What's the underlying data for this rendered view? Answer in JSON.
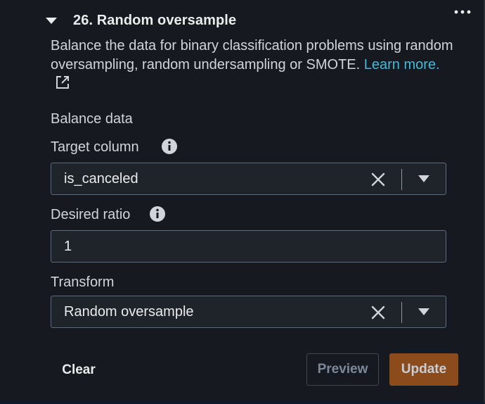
{
  "step": {
    "title": "26. Random oversample",
    "description": "Balance the data for binary classification problems using random oversampling, random undersampling or SMOTE.",
    "learn_more_label": "Learn more."
  },
  "section": {
    "label": "Balance data"
  },
  "target_column": {
    "label": "Target column",
    "value": "is_canceled"
  },
  "desired_ratio": {
    "label": "Desired ratio",
    "value": "1"
  },
  "transform": {
    "label": "Transform",
    "value": "Random oversample"
  },
  "buttons": {
    "clear_label": "Clear",
    "preview_label": "Preview",
    "update_label": "Update"
  },
  "colors": {
    "background": "#16191f",
    "link": "#44b9d6",
    "update_button": "#8c4b1b"
  },
  "icons": [
    "caret-down-icon",
    "more-options-icon",
    "external-link-icon",
    "info-icon",
    "clear-icon",
    "dropdown-arrow-icon"
  ]
}
